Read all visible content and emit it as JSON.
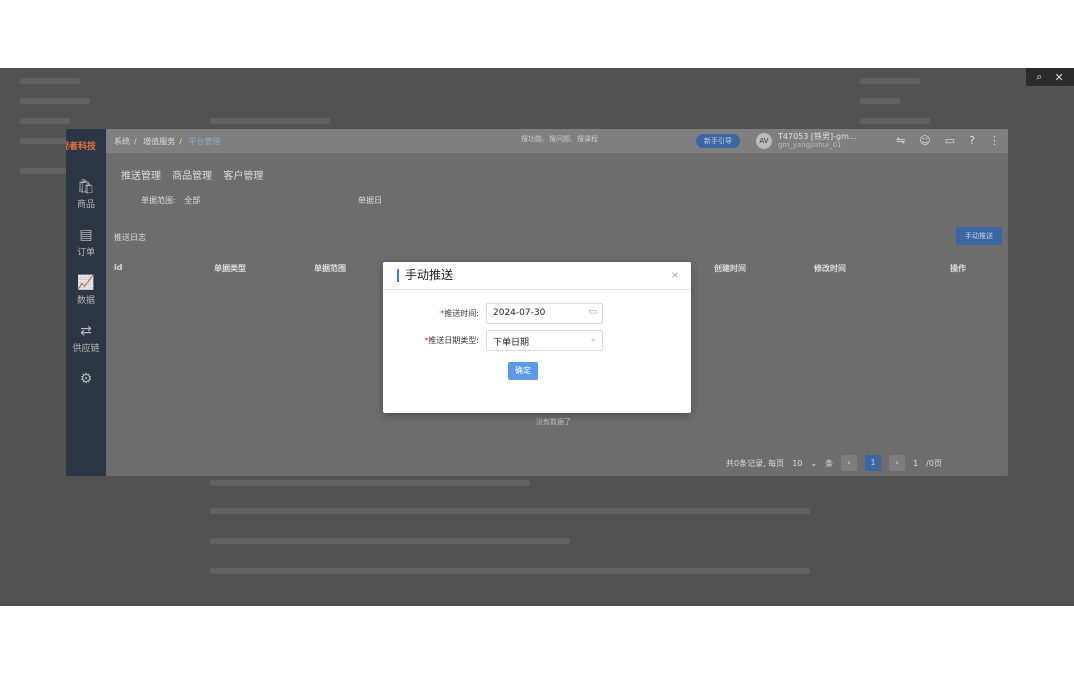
{
  "background": {
    "top_right_icons": [
      "search-icon",
      "close-icon"
    ],
    "top_right_glyphs": [
      "⌕",
      "✕"
    ]
  },
  "app": {
    "logo": "观者科技",
    "nav": [
      {
        "label": "商品",
        "icon": "bag-icon",
        "glyph": "🛍"
      },
      {
        "label": "订单",
        "icon": "order-icon",
        "glyph": "▤"
      },
      {
        "label": "数据",
        "icon": "chart-icon",
        "glyph": "📈"
      },
      {
        "label": "供应链",
        "icon": "chain-icon",
        "glyph": "⇄"
      },
      {
        "label": "",
        "icon": "settings-icon",
        "glyph": "⚙"
      }
    ],
    "breadcrumb": [
      "系统",
      "增值服务",
      "平台管理"
    ],
    "breadcrumb_sep": "/",
    "search_placeholder": "搜功能、搜问题、搜课程",
    "pill_button": "新手引导",
    "user_avatar": "AV",
    "user_name": "T47053 [铁男]-gm...",
    "user_sub": "gm_yangjiahui_01",
    "top_icons": [
      "switch-icon",
      "user-icon",
      "message-icon",
      "help-icon",
      "more-icon"
    ],
    "top_glyphs": [
      "⇋",
      "☺",
      "▭",
      "?",
      "⋮"
    ],
    "tabs": [
      "推送管理",
      "商品管理",
      "客户管理"
    ],
    "filter_label": "单据范围:",
    "filter_value": "全部",
    "filter2_label": "单据日",
    "log_title": "推送日志",
    "manual_push_btn": "手动推送",
    "columns": [
      "id",
      "单据类型",
      "单据范围",
      "创建时间",
      "修改时间",
      "操作"
    ],
    "no_data": "没有数据了",
    "pager": {
      "summary": "共0条记录, 每页",
      "page_size": "10",
      "unit": "条",
      "prev": "‹",
      "current": "1",
      "next": "›",
      "goto": "1",
      "total": "/0页"
    }
  },
  "modal": {
    "title": "手动推送",
    "close": "×",
    "fields": [
      {
        "required_mark": "*",
        "label": "推送时间:",
        "value": "2024-07-30",
        "icon": "calendar-icon",
        "glyph": "▭"
      },
      {
        "required_mark": "*",
        "label": "推送日期类型:",
        "value": "下单日期",
        "icon": "chevron-down-icon",
        "glyph": "⌄"
      }
    ],
    "confirm": "确定"
  }
}
